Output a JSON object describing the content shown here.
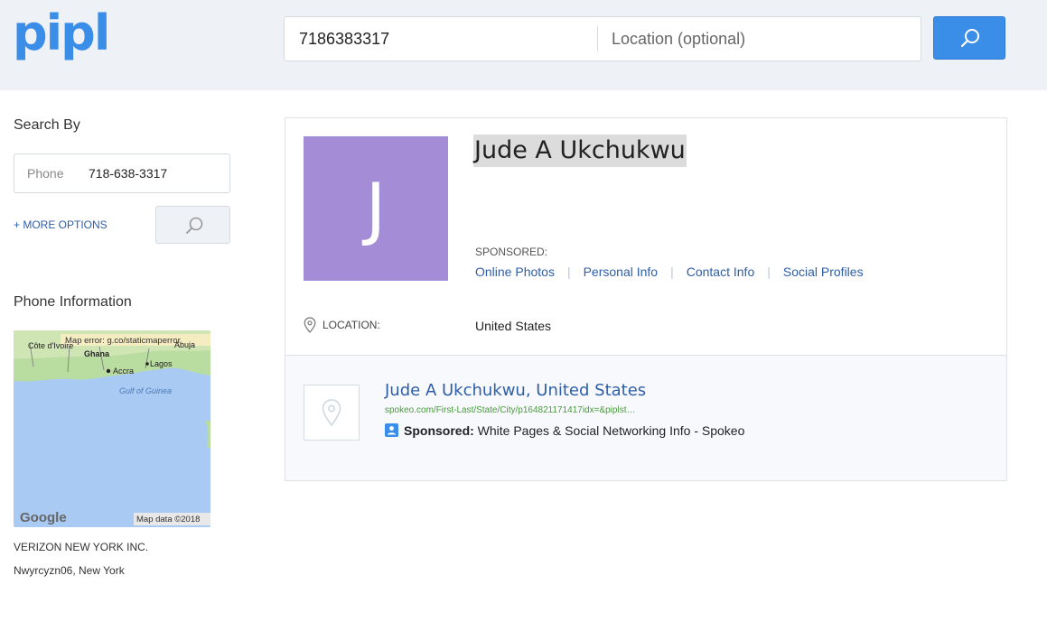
{
  "brand": {
    "logo": "pipl"
  },
  "search": {
    "query": "7186383317",
    "location_placeholder": "Location (optional)"
  },
  "sidebar": {
    "title": "Search By",
    "field_label": "Phone",
    "field_value": "718-638-3317",
    "more_options": "+ MORE OPTIONS",
    "phone_info_title": "Phone Information",
    "map": {
      "error": "Map error: g.co/staticmaperror",
      "labels": [
        "Côte d'Ivoire",
        "Ghana",
        "Accra",
        "Lagos",
        "Abuja",
        "Gulf of Guinea"
      ],
      "attribution_logo": "Google",
      "attribution": "Map data ©2018"
    },
    "carrier": "VERIZON NEW YORK INC.",
    "carrier_location": "Nwyrcyzn06, New York"
  },
  "result": {
    "initial": "J",
    "name": "Jude A Ukchukwu",
    "sponsored_label": "SPONSORED:",
    "links": [
      "Online Photos",
      "Personal Info",
      "Contact Info",
      "Social Profiles"
    ],
    "location_label": "LOCATION:",
    "location_value": "United States",
    "ad": {
      "title": "Jude A Ukchukwu, United States",
      "url": "spokeo.com/First-Last/State/City/p164821171417idx=&piplst…",
      "sponsored": "Sponsored:",
      "description": "White Pages & Social Networking Info - Spokeo"
    }
  },
  "colors": {
    "accent": "#3b8ee8",
    "avatar": "#a58cd6",
    "link": "#2f5ea8",
    "url": "#4a9a3c"
  }
}
